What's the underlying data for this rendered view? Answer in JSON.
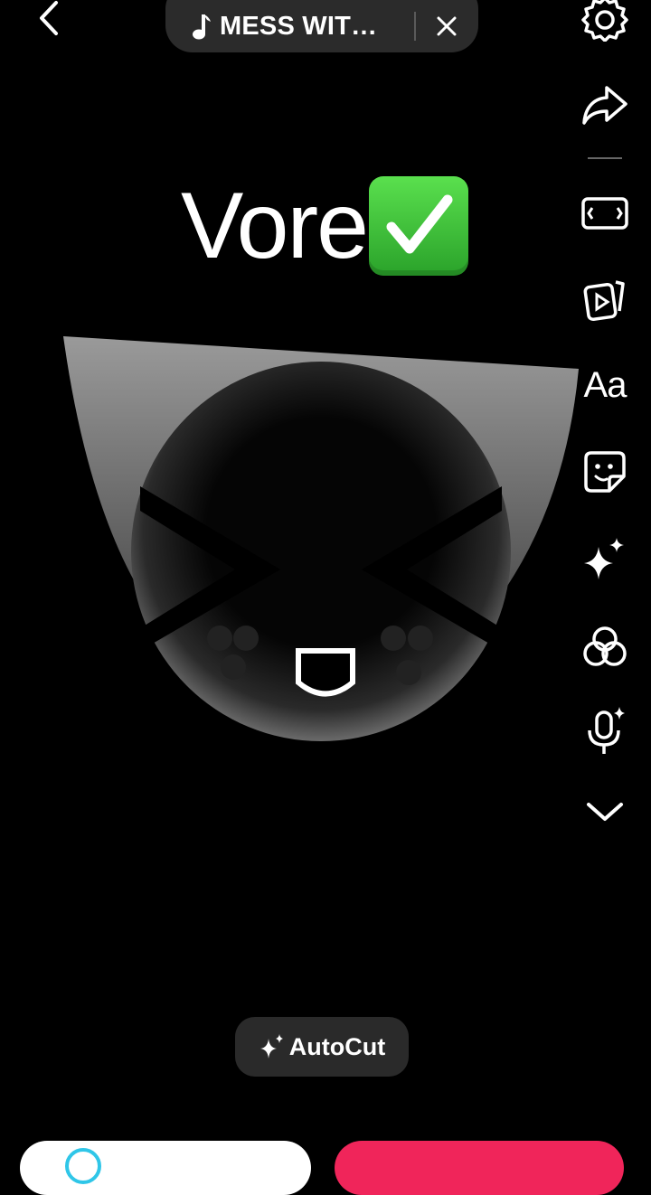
{
  "header": {
    "back_icon": "chevron-left-icon",
    "sound": {
      "icon": "music-note-icon",
      "title": "MESS WIT…",
      "close_icon": "close-icon"
    }
  },
  "right_toolbar": {
    "items": [
      {
        "icon": "settings-gear-icon"
      },
      {
        "icon": "share-arrow-icon"
      },
      {
        "icon": "aspect-ratio-icon"
      },
      {
        "icon": "templates-icon"
      },
      {
        "icon": "text-tool-icon",
        "label": "Aa"
      },
      {
        "icon": "sticker-icon"
      },
      {
        "icon": "effects-sparkle-icon"
      },
      {
        "icon": "filters-icon"
      },
      {
        "icon": "voice-effects-mic-icon"
      },
      {
        "icon": "expand-more-icon"
      }
    ]
  },
  "caption": {
    "text": "Vore",
    "emoji": "check-mark-button"
  },
  "autocut": {
    "icon": "sparkles-icon",
    "label": "AutoCut"
  },
  "colors": {
    "background": "#000000",
    "pill_bg": "#2b2b2b",
    "post_button": "#f0255a",
    "check_green": "#3cc23a",
    "accent_cyan": "#2fc6e8"
  }
}
